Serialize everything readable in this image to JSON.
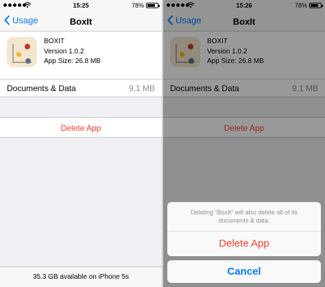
{
  "left": {
    "status": {
      "time": "15:25",
      "battery": "78%"
    },
    "nav": {
      "back_label": "Usage",
      "title": "BoxIt"
    },
    "app": {
      "name": "BOXIT",
      "version": "Version 1.0.2",
      "size": "App Size: 26.8 MB"
    },
    "docs": {
      "label": "Documents & Data",
      "value": "9.1 MB"
    },
    "delete_label": "Delete App",
    "footer": "35.3 GB available on iPhone 5s"
  },
  "right": {
    "status": {
      "time": "15:26",
      "battery": "78%"
    },
    "nav": {
      "back_label": "Usage",
      "title": "BoxIt"
    },
    "app": {
      "name": "BOXIT",
      "version": "Version 1.0.2",
      "size": "App Size: 26.8 MB"
    },
    "docs": {
      "label": "Documents & Data",
      "value": "9.1 MB"
    },
    "delete_label": "Delete App",
    "sheet": {
      "message": "Deleting “BoxIt” will also delete all of its documents & data.",
      "delete_label": "Delete App",
      "cancel_label": "Cancel"
    }
  },
  "colors": {
    "accent": "#007aff",
    "destructive": "#ff3b30",
    "icon_bg": "#f3e6cc"
  },
  "icons": [
    "signal-dots-icon",
    "wifi-icon",
    "battery-icon",
    "chevron-left-icon",
    "boxit-app-icon"
  ]
}
